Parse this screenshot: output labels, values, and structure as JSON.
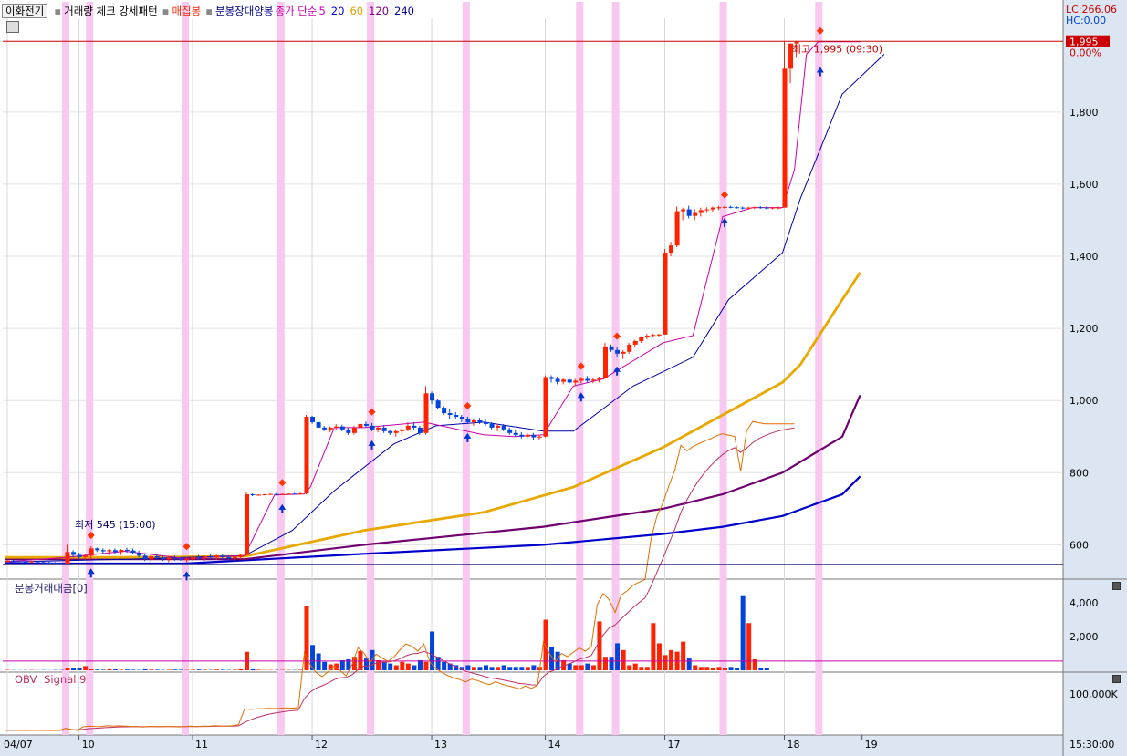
{
  "legend": {
    "stock_name": "이화전기",
    "items": [
      {
        "label": "거래량 체크 강세패턴",
        "color": "#000000"
      },
      {
        "label": "매집봉",
        "color": "#ff2200"
      },
      {
        "label": "분봉장대양봉",
        "color": "#000080"
      },
      {
        "label": "종가 단순",
        "color": "#cc00aa"
      },
      {
        "label": "5",
        "color": "#cc00aa"
      },
      {
        "label": "20",
        "color": "#0000cc"
      },
      {
        "label": "60",
        "color": "#e0a000"
      },
      {
        "label": "120",
        "color": "#800080"
      },
      {
        "label": "240",
        "color": "#000099"
      }
    ]
  },
  "header_right": {
    "lc": "LC:266.06",
    "hc": "HC:0.00"
  },
  "price_tag": {
    "value": "1,995",
    "pct": "0.00%"
  },
  "annotations": {
    "high": "최고 1,995 (09:30)",
    "low": "최저 545 (15:00)"
  },
  "x_axis": {
    "labels": [
      "04/07",
      "10",
      "11",
      "12",
      "13",
      "14",
      "17",
      "18",
      "19"
    ],
    "time": "15:30:00"
  },
  "colors": {
    "up": "#ff2200",
    "down": "#0044dd",
    "highlight": "#f8c8f0",
    "ma5": "#cc00aa",
    "ma20": "#0000aa",
    "ma60": "#e8a800",
    "ma120": "#700070",
    "ma240": "#0000cc"
  },
  "volume_panel": {
    "title": "분봉거래대금[0]",
    "ticks": [
      "4,000",
      "2,000"
    ]
  },
  "obv_panel": {
    "title": "OBV",
    "signal_label": "Signal 9",
    "tick": "100,000K"
  },
  "chart_data": {
    "type": "candlestick",
    "title": "",
    "price_axis": {
      "ylim": [
        510,
        2060
      ],
      "ticks": [
        600,
        800,
        1000,
        1200,
        1400,
        1600,
        1800
      ]
    },
    "high_line": 1995,
    "low_line": 545,
    "candles": [
      [
        555,
        558,
        552,
        556
      ],
      [
        556,
        558,
        553,
        554
      ],
      [
        554,
        556,
        551,
        553
      ],
      [
        553,
        555,
        550,
        552
      ],
      [
        552,
        556,
        550,
        554
      ],
      [
        554,
        556,
        551,
        552
      ],
      [
        552,
        554,
        549,
        551
      ],
      [
        551,
        553,
        548,
        550
      ],
      [
        550,
        552,
        547,
        549
      ],
      [
        549,
        551,
        545,
        548
      ],
      [
        548,
        600,
        547,
        580
      ],
      [
        580,
        585,
        565,
        572
      ],
      [
        572,
        578,
        560,
        566
      ],
      [
        566,
        574,
        558,
        570
      ],
      [
        570,
        596,
        560,
        590
      ],
      [
        590,
        592,
        580,
        585
      ],
      [
        585,
        590,
        575,
        582
      ],
      [
        582,
        588,
        572,
        585
      ],
      [
        585,
        590,
        575,
        580
      ],
      [
        580,
        588,
        572,
        586
      ],
      [
        586,
        592,
        578,
        584
      ],
      [
        584,
        590,
        575,
        578
      ],
      [
        578,
        584,
        565,
        570
      ],
      [
        570,
        576,
        555,
        560
      ],
      [
        560,
        575,
        552,
        568
      ],
      [
        568,
        574,
        558,
        565
      ],
      [
        565,
        570,
        555,
        560
      ],
      [
        560,
        566,
        552,
        564
      ],
      [
        564,
        570,
        556,
        562
      ],
      [
        562,
        566,
        555,
        559
      ],
      [
        559,
        565,
        552,
        560
      ],
      [
        560,
        570,
        556,
        566
      ],
      [
        566,
        572,
        558,
        564
      ],
      [
        564,
        570,
        556,
        568
      ],
      [
        568,
        574,
        560,
        565
      ],
      [
        565,
        572,
        558,
        570
      ],
      [
        570,
        576,
        560,
        566
      ],
      [
        566,
        570,
        556,
        562
      ],
      [
        562,
        568,
        555,
        566
      ],
      [
        566,
        575,
        560,
        572
      ],
      [
        572,
        745,
        570,
        740
      ],
      [
        740,
        742,
        735,
        738
      ],
      [
        738,
        740,
        736,
        739
      ],
      [
        739,
        741,
        737,
        740
      ],
      [
        740,
        742,
        738,
        741
      ],
      [
        741,
        743,
        739,
        740
      ],
      [
        740,
        742,
        738,
        741
      ],
      [
        741,
        743,
        739,
        742
      ],
      [
        742,
        744,
        740,
        741
      ],
      [
        741,
        745,
        740,
        742
      ],
      [
        742,
        960,
        740,
        955
      ],
      [
        955,
        958,
        935,
        940
      ],
      [
        940,
        945,
        920,
        925
      ],
      [
        925,
        930,
        915,
        920
      ],
      [
        920,
        928,
        912,
        925
      ],
      [
        925,
        935,
        920,
        928
      ],
      [
        928,
        933,
        915,
        920
      ],
      [
        920,
        925,
        905,
        910
      ],
      [
        910,
        930,
        905,
        925
      ],
      [
        925,
        945,
        920,
        935
      ],
      [
        935,
        942,
        925,
        930
      ],
      [
        930,
        938,
        915,
        920
      ],
      [
        920,
        930,
        912,
        925
      ],
      [
        925,
        932,
        910,
        915
      ],
      [
        915,
        920,
        905,
        910
      ],
      [
        910,
        920,
        900,
        915
      ],
      [
        915,
        925,
        905,
        920
      ],
      [
        920,
        940,
        915,
        930
      ],
      [
        930,
        940,
        920,
        925
      ],
      [
        925,
        930,
        905,
        910
      ],
      [
        910,
        1040,
        905,
        1020
      ],
      [
        1020,
        1025,
        990,
        1000
      ],
      [
        1000,
        1005,
        975,
        980
      ],
      [
        980,
        985,
        960,
        965
      ],
      [
        965,
        975,
        950,
        960
      ],
      [
        960,
        968,
        950,
        955
      ],
      [
        955,
        960,
        940,
        948
      ],
      [
        948,
        955,
        935,
        940
      ],
      [
        940,
        950,
        930,
        945
      ],
      [
        945,
        952,
        935,
        940
      ],
      [
        940,
        948,
        930,
        935
      ],
      [
        935,
        940,
        920,
        925
      ],
      [
        925,
        935,
        915,
        930
      ],
      [
        930,
        935,
        915,
        920
      ],
      [
        920,
        925,
        905,
        910
      ],
      [
        910,
        918,
        900,
        905
      ],
      [
        905,
        912,
        895,
        900
      ],
      [
        900,
        910,
        895,
        905
      ],
      [
        905,
        910,
        890,
        898
      ],
      [
        898,
        905,
        892,
        900
      ],
      [
        900,
        1070,
        898,
        1065
      ],
      [
        1065,
        1070,
        1050,
        1060
      ],
      [
        1060,
        1066,
        1045,
        1052
      ],
      [
        1052,
        1062,
        1045,
        1058
      ],
      [
        1058,
        1064,
        1046,
        1050
      ],
      [
        1050,
        1060,
        1040,
        1055
      ],
      [
        1055,
        1065,
        1048,
        1060
      ],
      [
        1060,
        1068,
        1050,
        1055
      ],
      [
        1055,
        1062,
        1048,
        1058
      ],
      [
        1058,
        1066,
        1050,
        1062
      ],
      [
        1062,
        1160,
        1060,
        1150
      ],
      [
        1150,
        1155,
        1135,
        1140
      ],
      [
        1140,
        1148,
        1120,
        1130
      ],
      [
        1130,
        1140,
        1115,
        1135
      ],
      [
        1135,
        1160,
        1130,
        1155
      ],
      [
        1155,
        1168,
        1150,
        1165
      ],
      [
        1165,
        1178,
        1160,
        1175
      ],
      [
        1175,
        1185,
        1170,
        1180
      ],
      [
        1180,
        1185,
        1175,
        1182
      ],
      [
        1182,
        1186,
        1178,
        1183
      ],
      [
        1183,
        1420,
        1183,
        1410
      ],
      [
        1410,
        1440,
        1400,
        1430
      ],
      [
        1430,
        1538,
        1425,
        1525
      ],
      [
        1525,
        1535,
        1500,
        1530
      ],
      [
        1530,
        1540,
        1505,
        1512
      ],
      [
        1512,
        1530,
        1500,
        1520
      ],
      [
        1520,
        1535,
        1510,
        1528
      ],
      [
        1528,
        1536,
        1520,
        1530
      ],
      [
        1530,
        1538,
        1522,
        1535
      ],
      [
        1535,
        1540,
        1528,
        1536
      ],
      [
        1536,
        1540,
        1532,
        1537
      ],
      [
        1537,
        1540,
        1533,
        1536
      ],
      [
        1536,
        1539,
        1532,
        1535
      ],
      [
        1535,
        1538,
        1530,
        1534
      ],
      [
        1534,
        1537,
        1530,
        1535
      ],
      [
        1535,
        1538,
        1531,
        1536
      ],
      [
        1536,
        1539,
        1532,
        1535
      ],
      [
        1535,
        1538,
        1530,
        1534
      ],
      [
        1534,
        1537,
        1530,
        1535
      ],
      [
        1535,
        1538,
        1531,
        1535
      ],
      [
        1535,
        1995,
        1740,
        1920
      ],
      [
        1920,
        1990,
        1880,
        1990
      ],
      [
        1990,
        1995,
        1950,
        1995
      ]
    ],
    "ma5_points": [
      [
        0,
        553
      ],
      [
        10,
        565
      ],
      [
        20,
        582
      ],
      [
        30,
        562
      ],
      [
        40,
        570
      ],
      [
        45,
        738
      ],
      [
        50,
        741
      ],
      [
        51,
        760
      ],
      [
        55,
        925
      ],
      [
        60,
        925
      ],
      [
        70,
        940
      ],
      [
        80,
        905
      ],
      [
        85,
        900
      ],
      [
        90,
        905
      ],
      [
        95,
        1040
      ],
      [
        100,
        1060
      ],
      [
        110,
        1160
      ],
      [
        115,
        1180
      ],
      [
        120,
        1510
      ],
      [
        125,
        1535
      ],
      [
        130,
        1535
      ],
      [
        132,
        1640
      ],
      [
        134,
        1960
      ],
      [
        136,
        1995
      ],
      [
        143,
        1995
      ]
    ],
    "ma20_points": [
      [
        0,
        552
      ],
      [
        20,
        560
      ],
      [
        40,
        570
      ],
      [
        48,
        640
      ],
      [
        55,
        750
      ],
      [
        65,
        880
      ],
      [
        72,
        930
      ],
      [
        80,
        940
      ],
      [
        90,
        915
      ],
      [
        95,
        915
      ],
      [
        105,
        1040
      ],
      [
        115,
        1120
      ],
      [
        121,
        1280
      ],
      [
        130,
        1410
      ],
      [
        133,
        1560
      ],
      [
        140,
        1850
      ],
      [
        147,
        1960
      ]
    ],
    "ma60_points": [
      [
        0,
        565
      ],
      [
        20,
        565
      ],
      [
        40,
        568
      ],
      [
        60,
        640
      ],
      [
        80,
        690
      ],
      [
        95,
        760
      ],
      [
        110,
        870
      ],
      [
        120,
        960
      ],
      [
        130,
        1050
      ],
      [
        133,
        1100
      ],
      [
        140,
        1280
      ],
      [
        143,
        1355
      ]
    ],
    "ma120_points": [
      [
        0,
        560
      ],
      [
        40,
        560
      ],
      [
        60,
        600
      ],
      [
        90,
        650
      ],
      [
        110,
        700
      ],
      [
        120,
        740
      ],
      [
        130,
        800
      ],
      [
        140,
        900
      ],
      [
        143,
        1015
      ]
    ],
    "ma240_points": [
      [
        0,
        548
      ],
      [
        30,
        548
      ],
      [
        60,
        575
      ],
      [
        90,
        600
      ],
      [
        110,
        630
      ],
      [
        120,
        650
      ],
      [
        130,
        680
      ],
      [
        140,
        740
      ],
      [
        143,
        790
      ]
    ],
    "highlight_bars": [
      10,
      14,
      30,
      46,
      61,
      77,
      96,
      102,
      120,
      136
    ],
    "volume": {
      "ylim": [
        0,
        4600
      ],
      "threshold": 550,
      "values": [
        20,
        15,
        10,
        15,
        20,
        10,
        15,
        10,
        20,
        20,
        150,
        120,
        150,
        250,
        50,
        40,
        30,
        60,
        50,
        30,
        40,
        30,
        20,
        60,
        40,
        30,
        20,
        30,
        40,
        30,
        20,
        30,
        40,
        30,
        20,
        40,
        30,
        20,
        30,
        60,
        1100,
        60,
        30,
        20,
        20,
        20,
        20,
        20,
        20,
        30,
        3800,
        1500,
        1000,
        500,
        350,
        400,
        600,
        650,
        800,
        1150,
        700,
        1200,
        600,
        500,
        400,
        300,
        500,
        400,
        300,
        600,
        500,
        2300,
        800,
        500,
        400,
        300,
        200,
        300,
        200,
        200,
        300,
        200,
        200,
        300,
        200,
        200,
        200,
        200,
        300,
        200,
        3000,
        1400,
        1100,
        600,
        400,
        300,
        300,
        400,
        300,
        2900,
        800,
        800,
        1600,
        1200,
        300,
        400,
        200,
        200,
        2800,
        1600,
        900,
        1200,
        1100,
        1700,
        700,
        300,
        200,
        200,
        150,
        200,
        150,
        200,
        150,
        4400,
        2800,
        650,
        150,
        150
      ]
    },
    "obv": {
      "ylim": [
        -10,
        140
      ],
      "tick": 100
    }
  }
}
